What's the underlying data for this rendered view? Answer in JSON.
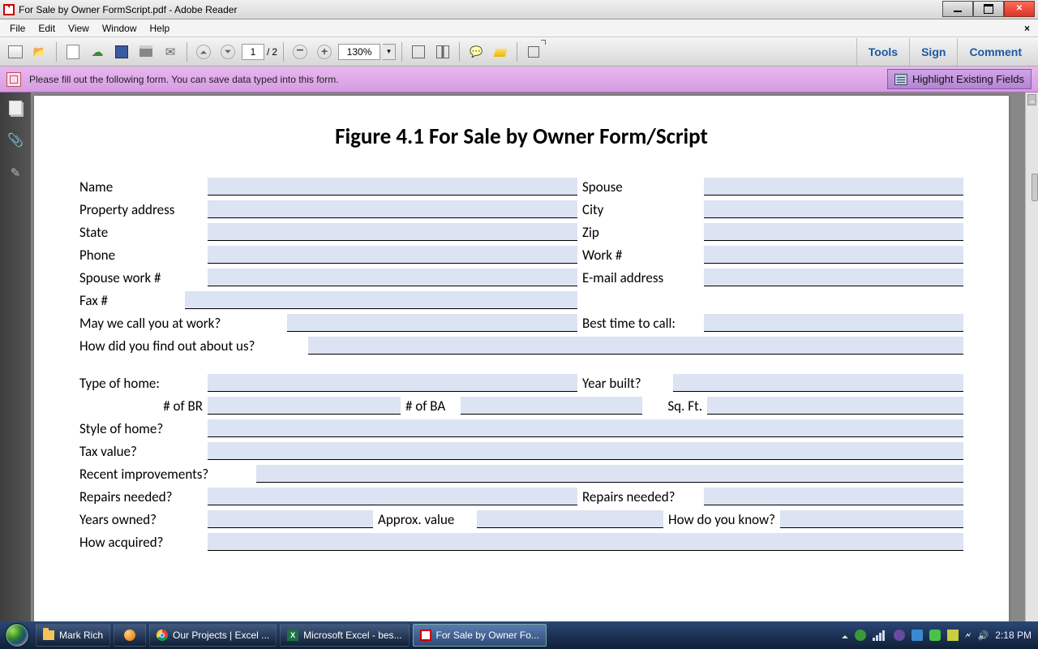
{
  "window": {
    "title": "For Sale by Owner FormScript.pdf - Adobe Reader"
  },
  "menu": {
    "file": "File",
    "edit": "Edit",
    "view": "View",
    "window": "Window",
    "help": "Help"
  },
  "toolbar": {
    "page_current": "1",
    "page_sep": "/",
    "page_total": "2",
    "zoom": "130%",
    "links": {
      "tools": "Tools",
      "sign": "Sign",
      "comment": "Comment"
    }
  },
  "infobar": {
    "msg": "Please fill out the following form. You can save data typed into this form.",
    "highlight_btn": "Highlight Existing Fields"
  },
  "doc": {
    "heading": "Figure 4.1 For Sale by Owner Form/Script",
    "labels": {
      "name": "Name",
      "spouse": "Spouse",
      "prop_addr": "Property address",
      "city": "City",
      "state": "State",
      "zip": "Zip",
      "phone": "Phone",
      "work": "Work #",
      "spouse_work": "Spouse work #",
      "email": "E-mail address",
      "fax": "Fax #",
      "call_work": "May we call you at work?",
      "best_time": "Best time to call:",
      "find_out": "How did you find out about us?",
      "type_home": "Type of home:",
      "year_built": "Year built?",
      "br": "# of BR",
      "ba": "# of BA",
      "sqft": "Sq. Ft.",
      "style": "Style of home?",
      "taxval": "Tax value?",
      "improvements": "Recent improvements?",
      "repairs1": "Repairs needed?",
      "repairs2": "Repairs needed?",
      "years_owned": "Years owned?",
      "approx_val": "Approx. value",
      "how_know": "How do you know?",
      "acquired": "How acquired?"
    }
  },
  "taskbar": {
    "items": [
      "Mark Rich",
      "",
      "Our Projects | Excel ...",
      "Microsoft Excel - bes...",
      "For Sale by Owner Fo..."
    ],
    "clock": "2:18 PM"
  }
}
